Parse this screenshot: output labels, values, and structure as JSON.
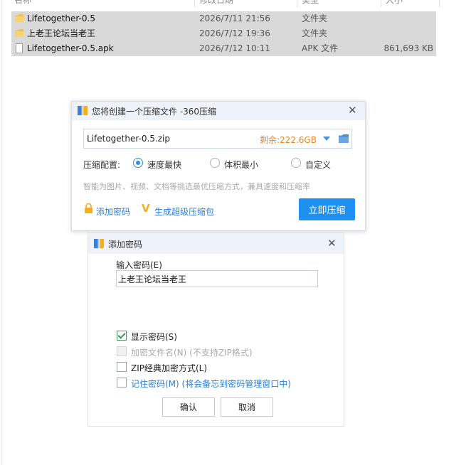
{
  "explorer": {
    "columns": [
      "名称",
      "修改日期",
      "类型",
      "大小"
    ],
    "files": [
      {
        "name": "Lifetogether-0.5",
        "date": "2026/7/11 21:56",
        "type": "文件夹",
        "size": "",
        "icon": "folder-icon"
      },
      {
        "name": "上老王论坛当老王",
        "date": "2026/7/12 19:36",
        "type": "文件夹",
        "size": "",
        "icon": "folder-icon"
      },
      {
        "name": "Lifetogether-0.5.apk",
        "date": "2026/7/12 10:11",
        "type": "APK 文件",
        "size": "861,693 KB",
        "icon": "file-icon"
      }
    ]
  },
  "compress_dialog": {
    "title": "您将创建一个压缩文件 -360压缩",
    "filename": "Lifetogether-0.5.zip",
    "free_space": "剩余:222.6GB",
    "config_label": "压缩配置:",
    "options": [
      {
        "label": "速度最快",
        "selected": true
      },
      {
        "label": "体积最小",
        "selected": false
      },
      {
        "label": "自定义",
        "selected": false
      }
    ],
    "hint": "智能为图片、视频、文档等挑选最优压缩方式，兼具速度和压缩率",
    "add_password_link": "添加密码",
    "super_pack_link": "生成超级压缩包",
    "compress_button": "立即压缩"
  },
  "password_dialog": {
    "title": "添加密码",
    "input_label": "输入密码(E)",
    "password_value": "上老王论坛当老王",
    "checkboxes": [
      {
        "label": "显示密码(S)",
        "checked": true,
        "disabled": false
      },
      {
        "label": "加密文件名(N) (不支持ZIP格式)",
        "checked": false,
        "disabled": true
      },
      {
        "label": "ZIP经典加密方式(L)",
        "checked": false,
        "disabled": false
      },
      {
        "label": "记住密码(M) (将会备忘到密码管理窗口中)",
        "checked": false,
        "disabled": false
      }
    ],
    "ok_button": "确认",
    "cancel_button": "取消"
  },
  "colors": {
    "accent": "#1e90f0",
    "warning": "#e3892b",
    "link": "#2b7fd0",
    "selection": "#d9d9d9"
  }
}
